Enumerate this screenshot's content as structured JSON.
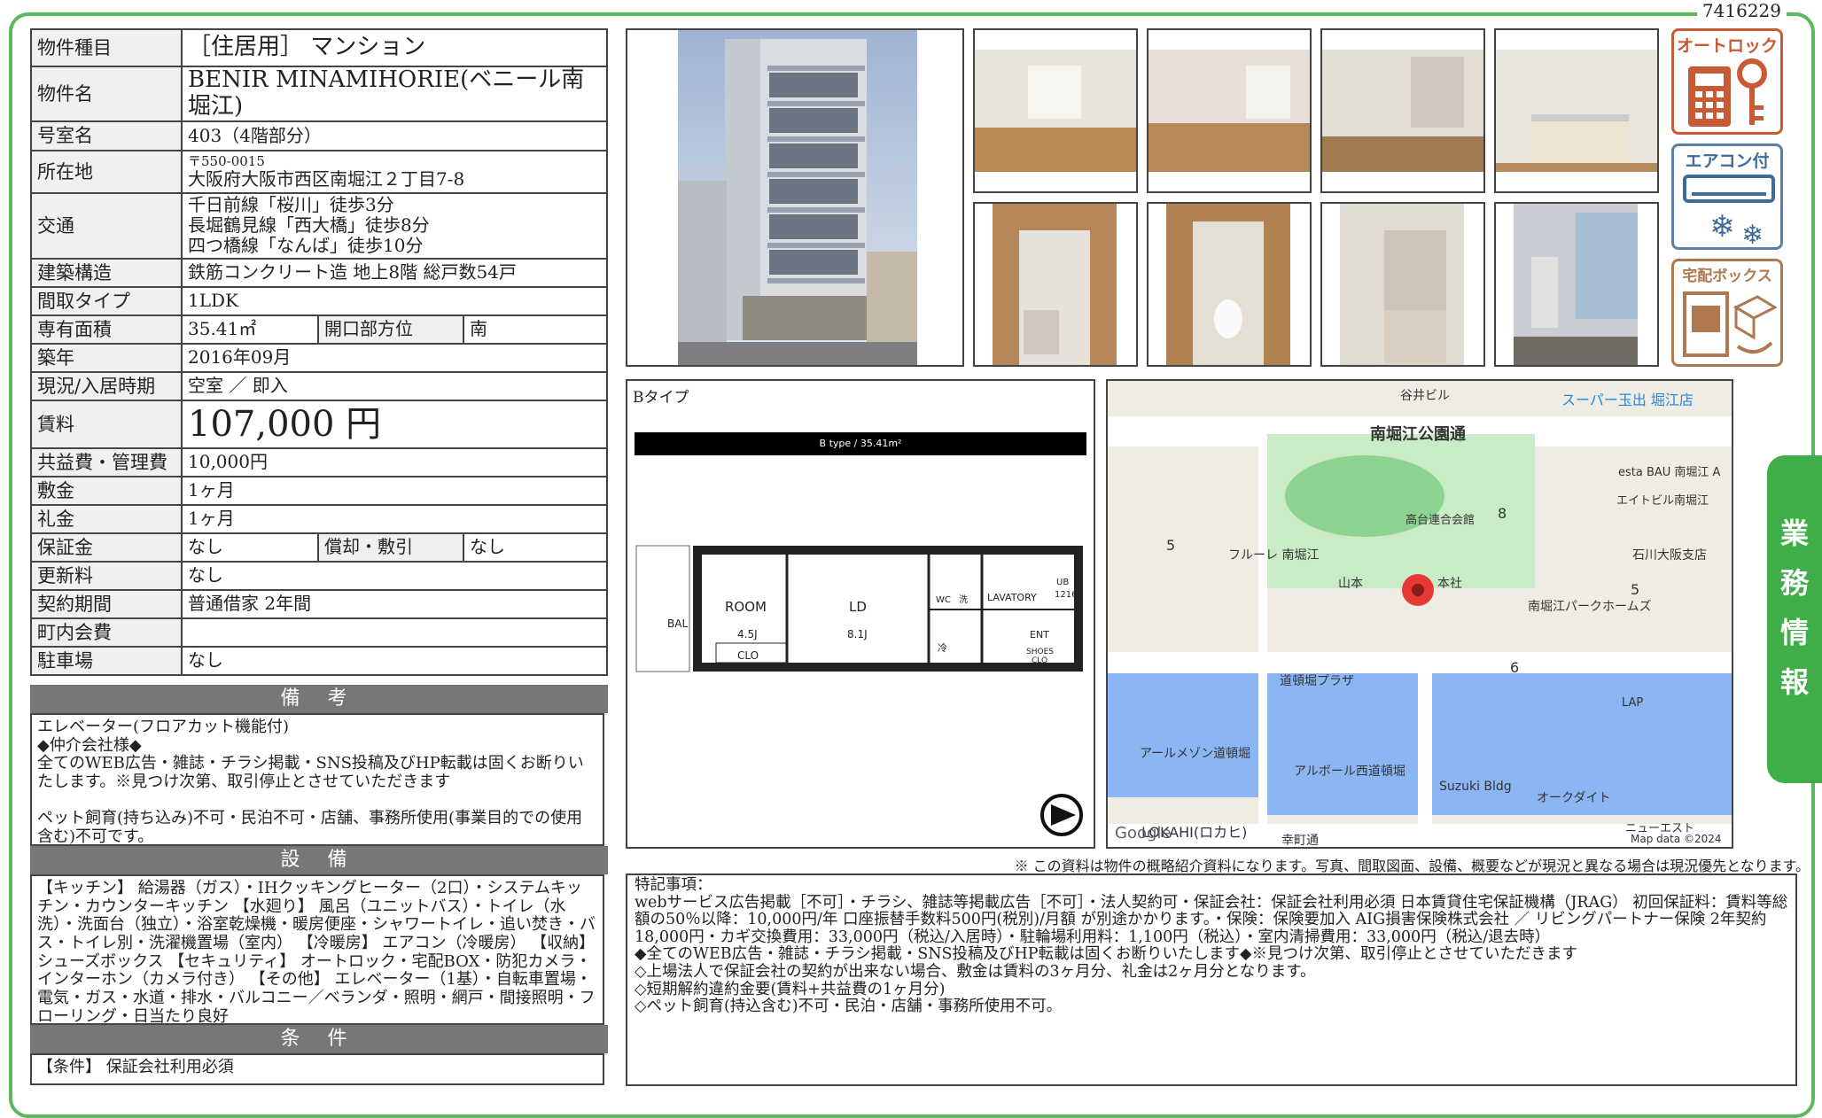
{
  "doc_id": "7416229",
  "property": {
    "type_label": "物件種目",
    "type_value": "［住居用］ マンション",
    "name_label": "物件名",
    "name_value": "BENIR MINAMIHORIE(ベニール南堀江)",
    "room_label": "号室名",
    "room_value": "403（4階部分）",
    "addr_label": "所在地",
    "zip": "〒550-0015",
    "addr_value": "大阪府大阪市西区南堀江２丁目7-8",
    "access_label": "交通",
    "access": [
      "千日前線「桜川」徒歩3分",
      "長堀鶴見線「西大橋」徒歩8分",
      "四つ橋線「なんば」徒歩10分"
    ],
    "structure_label": "建築構造",
    "structure_value": "鉄筋コンクリート造 地上8階 総戸数54戸",
    "layout_label": "間取タイプ",
    "layout_value": "1LDK",
    "area_label": "専有面積",
    "area_value": "35.41㎡",
    "dir_label": "開口部方位",
    "dir_value": "南",
    "built_label": "築年",
    "built_value": "2016年09月",
    "status_label": "現況/入居時期",
    "status_value": "空室 ／ 即入",
    "rent_label": "賃料",
    "rent_value": "107,000 円",
    "fee_label": "共益費・管理費",
    "fee_value": "10,000円",
    "deposit_label": "敷金",
    "deposit_value": "1ヶ月",
    "key_label": "礼金",
    "key_value": "1ヶ月",
    "guar_label": "保証金",
    "guar_value": "なし",
    "amort_label": "償却・敷引",
    "amort_value": "なし",
    "renew_label": "更新料",
    "renew_value": "なし",
    "contract_label": "契約期間",
    "contract_value": "普通借家 2年間",
    "assoc_label": "町内会費",
    "assoc_value": "",
    "parking_label": "駐車場",
    "parking_value": "なし"
  },
  "remarks": {
    "title": "備 考",
    "text": "エレベーター(フロアカット機能付)\n◆仲介会社様◆\n全てのWEB広告・雑誌・チラシ掲載・SNS投稿及びHP転載は固くお断りいたします。※見つけ次第、取引停止とさせていただきます\n\nペット飼育(持ち込み)不可・民泊不可・店舗、事務所使用(事業目的での使用含む)不可です。"
  },
  "equipment": {
    "title": "設 備",
    "text": "【キッチン】 給湯器（ガス）・IHクッキングヒーター（2口）・システムキッチン・カウンターキッチン 【水廻り】 風呂（ユニットバス）・トイレ（水洗）・洗面台（独立）・浴室乾燥機・暖房便座・シャワートイレ・追い焚き・バス・トイレ別・洗濯機置場（室内） 【冷暖房】 エアコン（冷暖房） 【収納】 シューズボックス 【セキュリティ】 オートロック・宅配BOX・防犯カメラ・インターホン（カメラ付き） 【その他】 エレベーター（1基）・自転車置場・電気・ガス・水道・排水・バルコニー／ベランダ・照明・網戸・間接照明・フローリング・日当たり良好"
  },
  "conditions": {
    "title": "条 件",
    "text": "【条件】 保証会社利用必須"
  },
  "icons": {
    "autolock": "オートロック",
    "aircon": "エアコン付",
    "delivery": "宅配ボックス"
  },
  "floorplan": {
    "label": "Bタイプ",
    "header": "B type / 35.41m²",
    "rooms": {
      "bal": "BAL",
      "room": "ROOM",
      "room_size": "4.5J",
      "ld": "LD",
      "ld_size": "8.1J",
      "clo": "CLO",
      "wc": "WC",
      "lavatory": "LAVATORY",
      "ub": "UB",
      "ub_num": "1216",
      "ent": "ENT",
      "shoes": "SHOES",
      "shoes_clo": "CLO",
      "rei": "冷",
      "sen": "洗"
    }
  },
  "map": {
    "labels": {
      "taniibiru": "谷井ビル",
      "super": "スーパー玉出 堀江店",
      "park": "南堀江公園通",
      "estabau": "esta BAU 南堀江 A",
      "eito": "エイトビル南堀江",
      "takadai": "高台連合会館",
      "n8": "8",
      "n5a": "5",
      "n5b": "5",
      "n6": "6",
      "furure": "フルーレ 南堀江",
      "ishikawa": "石川大阪支店",
      "yamamoto": "山本",
      "sha": "本社",
      "parkhomes": "南堀江パークホームズ",
      "dotonbori": "道頓堀プラザ",
      "lap": "LAP",
      "armaison": "アールメゾン道頓堀",
      "alboll": "アルボール西道頓堀",
      "suzuki": "Suzuki Bldg",
      "okudaito": "オークダイト",
      "lokahi": "LOKAHI(ロカヒ)",
      "saiwai": "幸町通",
      "newest": "ニューエスト",
      "google": "Google",
      "mapdata": "Map data ©2024"
    }
  },
  "disclaimer": "※ この資料は物件の概略紹介資料になります。写真、間取図面、設備、概要などが現況と異なる場合は現況優先となります。",
  "special": {
    "text": "特記事項：\nwebサービス広告掲載［不可］・チラシ、雑誌等掲載広告［不可］・法人契約可・保証会社：保証会社利用必須 日本賃貸住宅保証機構（JRAG） 初回保証料：賃料等総額の50％以降：10,000円/年 口座振替手数料500円(税別)/月額 が別途かかります。・保険：保険要加入 AIG損害保険株式会社 ／ リビングパートナー保険 2年契約 18,000円・カギ交換費用：33,000円（税込/入居時）・駐輪場利用料：1,100円（税込）・室内清掃費用：33,000円（税込/退去時）\n◆全てのWEB広告・雑誌・チラシ掲載・SNS投稿及びHP転載は固くお断りいたします◆※見つけ次第、取引停止とさせていただきます\n◇上場法人で保証会社の契約が出来ない場合、敷金は賃料の3ヶ月分、礼金は2ヶ月分となります。\n◇短期解約違約金要(賃料+共益費の1ヶ月分)\n◇ペット飼育(持込含む)不可・民泊・店舗・事務所使用不可。"
  },
  "side_tab": [
    "業",
    "務",
    "情",
    "報"
  ]
}
